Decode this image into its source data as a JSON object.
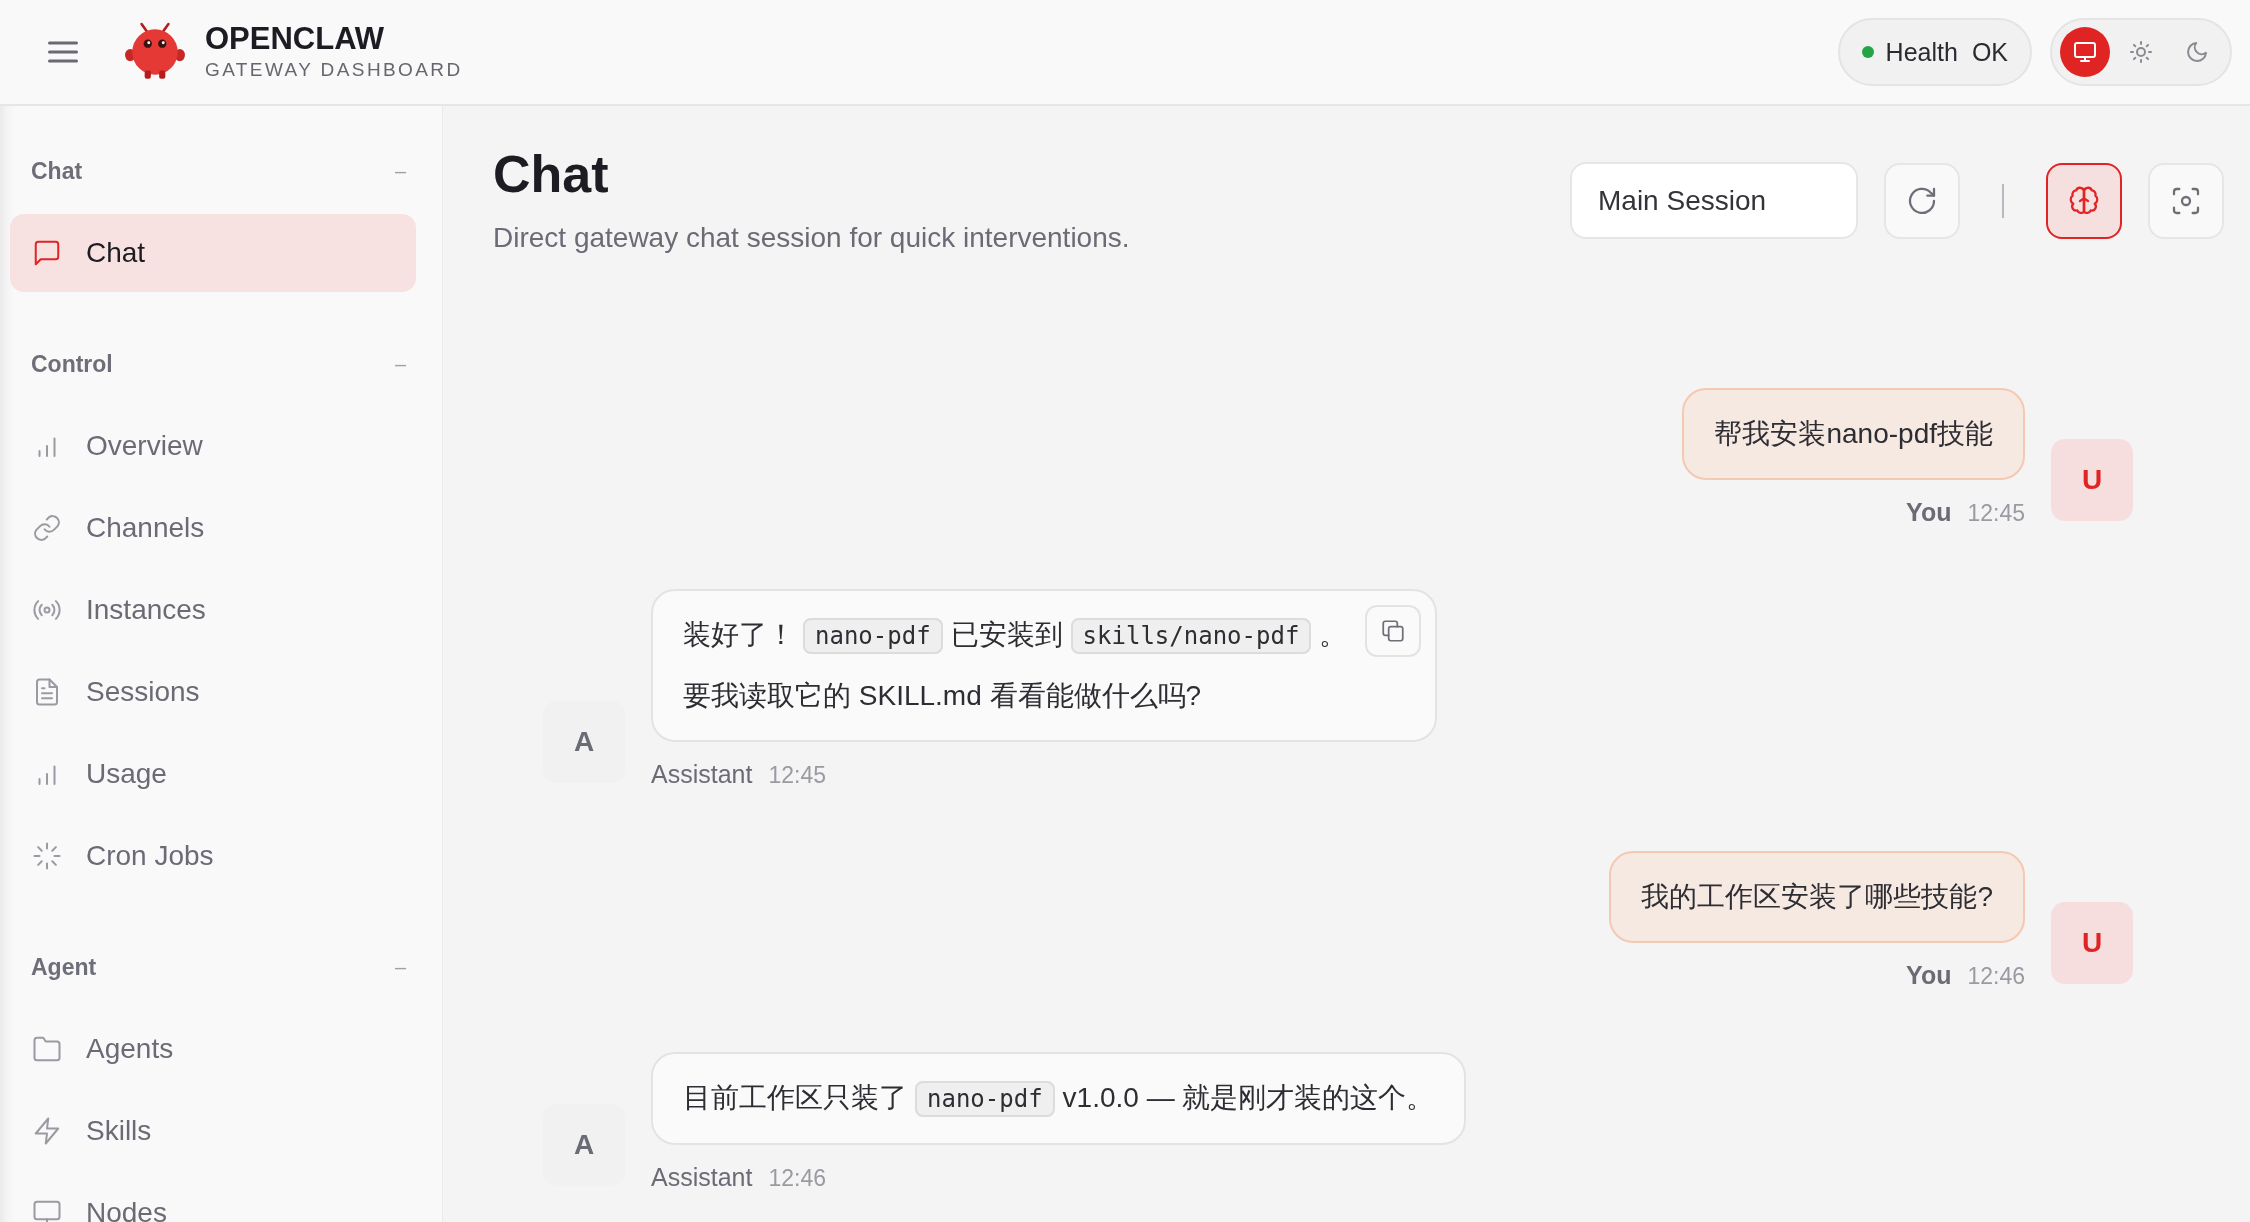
{
  "header": {
    "brand": "OPENCLAW",
    "subtitle": "GATEWAY DASHBOARD",
    "health": {
      "label": "Health",
      "value": "OK",
      "ok": true
    },
    "theme_options": [
      {
        "kind": "system",
        "selected": true
      },
      {
        "kind": "light",
        "selected": false
      },
      {
        "kind": "dark",
        "selected": false
      }
    ]
  },
  "sidebar": {
    "sections": [
      {
        "title": "Chat",
        "toggle": "–",
        "items": [
          {
            "label": "Chat",
            "kind": "chat",
            "selected": true
          }
        ]
      },
      {
        "title": "Control",
        "toggle": "–",
        "items": [
          {
            "label": "Overview",
            "kind": "bars",
            "selected": false
          },
          {
            "label": "Channels",
            "kind": "link",
            "selected": false
          },
          {
            "label": "Instances",
            "kind": "radio",
            "selected": false
          },
          {
            "label": "Sessions",
            "kind": "file",
            "selected": false
          },
          {
            "label": "Usage",
            "kind": "bars",
            "selected": false
          },
          {
            "label": "Cron Jobs",
            "kind": "loader",
            "selected": false
          }
        ]
      },
      {
        "title": "Agent",
        "toggle": "–",
        "items": [
          {
            "label": "Agents",
            "kind": "folder",
            "selected": false
          },
          {
            "label": "Skills",
            "kind": "zap",
            "selected": false
          },
          {
            "label": "Nodes",
            "kind": "monitor",
            "selected": false
          }
        ]
      }
    ]
  },
  "page": {
    "title": "Chat",
    "subtitle": "Direct gateway chat session for quick interventions.",
    "session": "Main Session",
    "toolbar": [
      {
        "kind": "refresh",
        "on": false
      },
      {
        "kind": "divider"
      },
      {
        "kind": "thinking",
        "on": true
      },
      {
        "kind": "focus",
        "on": false
      }
    ]
  },
  "messages": [
    {
      "kind": "user",
      "avatar": "U",
      "author": "You",
      "time": "12:45",
      "copy_button": false,
      "paragraphs": [
        [
          {
            "kind": "text",
            "text": "帮我安装nano-pdf技能"
          }
        ]
      ]
    },
    {
      "kind": "assistant",
      "avatar": "A",
      "author": "Assistant",
      "time": "12:45",
      "copy_button": true,
      "paragraphs": [
        [
          {
            "kind": "text",
            "text": "装好了！"
          },
          {
            "kind": "code",
            "text": "nano-pdf"
          },
          {
            "kind": "text",
            "text": "已安装到"
          },
          {
            "kind": "code",
            "text": "skills/nano-pdf"
          },
          {
            "kind": "text",
            "text": "。"
          }
        ],
        [
          {
            "kind": "text",
            "text": "要我读取它的 SKILL.md 看看能做什么吗?"
          }
        ]
      ]
    },
    {
      "kind": "user",
      "avatar": "U",
      "author": "You",
      "time": "12:46",
      "copy_button": false,
      "paragraphs": [
        [
          {
            "kind": "text",
            "text": "我的工作区安装了哪些技能?"
          }
        ]
      ]
    },
    {
      "kind": "assistant",
      "avatar": "A",
      "author": "Assistant",
      "time": "12:46",
      "copy_button": false,
      "paragraphs": [
        [
          {
            "kind": "text",
            "text": "目前工作区只装了"
          },
          {
            "kind": "code",
            "text": "nano-pdf"
          },
          {
            "kind": "text",
            "text": "v1.0.0 — 就是刚才装的这个。"
          }
        ]
      ]
    }
  ]
}
